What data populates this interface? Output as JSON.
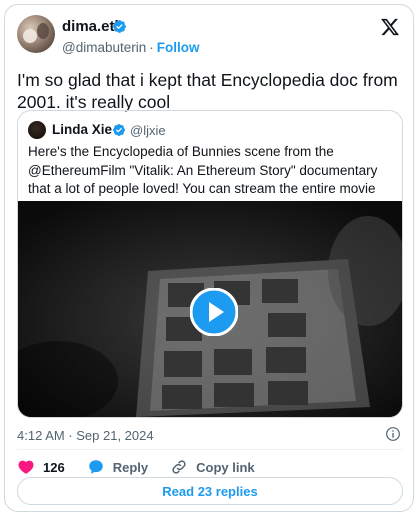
{
  "author": {
    "display_name": "dima.eth",
    "handle": "@dimabuterin",
    "separator": "·",
    "follow_label": "Follow"
  },
  "tweet": {
    "text": "I'm so glad that i kept that Encyclopedia doc from 2001. it's really cool",
    "timestamp": "4:12 AM · Sep 21, 2024"
  },
  "quote": {
    "display_name": "Linda Xie",
    "handle": "@ljxie",
    "text": "Here's the Encyclopedia of Bunnies scene from the @EthereumFilm \"Vitalik: An Ethereum Story\" documentary that a lot of people loved! You can stream the entire movie now at ethereumfilm.xyz"
  },
  "actions": {
    "like_count": "126",
    "reply_label": "Reply",
    "copy_link_label": "Copy link"
  },
  "read_replies_label": "Read 23 replies",
  "colors": {
    "accent": "#1d9bf0",
    "like": "#f91880",
    "text": "#0f1419",
    "muted": "#536471",
    "border": "#cfd9de"
  },
  "icons": [
    "verified-badge-icon",
    "x-logo-icon",
    "play-icon",
    "info-icon",
    "heart-icon",
    "reply-icon",
    "link-icon"
  ]
}
